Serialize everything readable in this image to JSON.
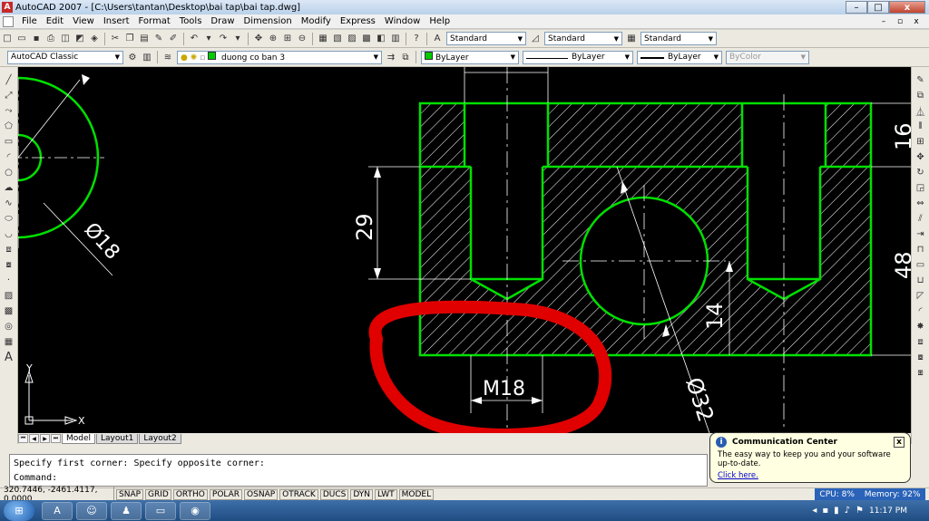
{
  "window": {
    "title": "AutoCAD 2007 - [C:\\Users\\tantan\\Desktop\\bai tap\\bai tap.dwg]",
    "minimize": "–",
    "maximize": "□",
    "close": "x"
  },
  "menu": {
    "items": [
      "File",
      "Edit",
      "View",
      "Insert",
      "Format",
      "Tools",
      "Draw",
      "Dimension",
      "Modify",
      "Express",
      "Window",
      "Help"
    ],
    "mdi_min": "–",
    "mdi_max": "▫",
    "mdi_close": "x"
  },
  "toolbar_standard": {
    "text_style": "Standard",
    "dim_style": "Standard",
    "table_style": "Standard"
  },
  "toolbar_layers": {
    "workspace": "AutoCAD Classic",
    "layer": "duong co ban 3",
    "color": "ByLayer",
    "color_swatch": "#00cc00",
    "linetype": "ByLayer",
    "lineweight": "ByLayer",
    "plotstyle": "ByColor"
  },
  "drawing": {
    "line_color": "#00e000",
    "text_color": "#ffffff",
    "annotation_color": "#e00000",
    "dimensions": {
      "d_top": "16",
      "d_left": "29",
      "d_right": "48",
      "d_small": "14",
      "d_circle": "Ø32",
      "d_left_circle": "Ø18",
      "d_thread": "M18"
    },
    "ucs": {
      "x": "X",
      "y": "Y"
    }
  },
  "tabs": {
    "items": [
      "Model",
      "Layout1",
      "Layout2"
    ],
    "active": 0
  },
  "command": {
    "history": "Specify first corner: Specify opposite corner:",
    "prompt": "Command:"
  },
  "comm_center": {
    "title": "Communication Center",
    "body": "The easy way to keep you and your software up-to-date.",
    "link": "Click here.",
    "close": "x"
  },
  "status": {
    "coords": "320.7446, -2461.4117, 0.0000",
    "buttons": [
      "SNAP",
      "GRID",
      "ORTHO",
      "POLAR",
      "OSNAP",
      "OTRACK",
      "DUCS",
      "DYN",
      "LWT",
      "MODEL"
    ],
    "cpu": "CPU: 8%",
    "memory": "Memory: 92%"
  },
  "taskbar": {
    "time": "11:17 PM"
  }
}
